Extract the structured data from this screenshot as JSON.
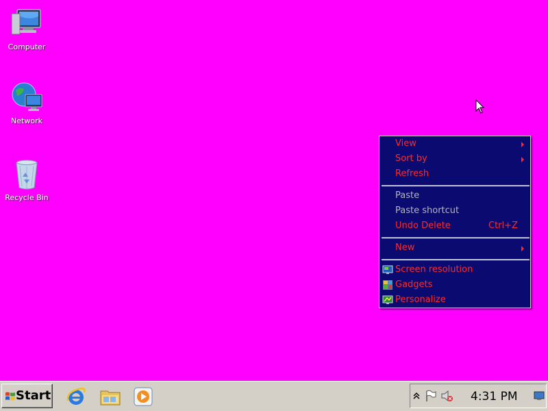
{
  "desktop": {
    "background": "#ff00ff",
    "icons": [
      {
        "label": "Computer",
        "icon": "computer-icon"
      },
      {
        "label": "Network",
        "icon": "network-icon"
      },
      {
        "label": "Recycle Bin",
        "icon": "recycle-bin-icon"
      }
    ]
  },
  "context_menu": {
    "background": "#0a0a70",
    "text_color": "#ff2a2a",
    "disabled_color": "#b4b4c8",
    "items": [
      {
        "label": "View",
        "submenu": true
      },
      {
        "label": "Sort by",
        "submenu": true
      },
      {
        "label": "Refresh"
      },
      {
        "label": "Paste",
        "disabled": true
      },
      {
        "label": "Paste shortcut",
        "disabled": true
      },
      {
        "label": "Undo Delete",
        "shortcut": "Ctrl+Z"
      },
      {
        "label": "New",
        "submenu": true
      },
      {
        "label": "Screen resolution",
        "icon": "screen-resolution-icon"
      },
      {
        "label": "Gadgets",
        "icon": "gadgets-icon"
      },
      {
        "label": "Personalize",
        "icon": "personalize-icon"
      }
    ]
  },
  "taskbar": {
    "start_label": "Start",
    "quick_launch": [
      "internet-explorer-icon",
      "windows-explorer-icon",
      "media-player-icon"
    ],
    "tray": {
      "icons": [
        "show-hidden-icons-chevron",
        "action-center-flag-icon",
        "volume-muted-icon",
        "show-desktop-icon"
      ],
      "clock": "4:31 PM"
    }
  }
}
